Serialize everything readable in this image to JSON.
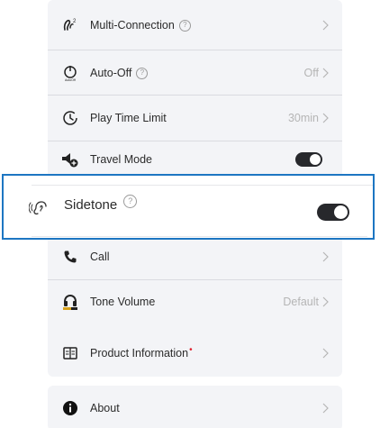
{
  "settings": {
    "multi_connection": {
      "label": "Multi-Connection",
      "icon": "multi-connection-icon"
    },
    "auto_off": {
      "label": "Auto-Off",
      "value": "Off",
      "icon": "auto-off-icon"
    },
    "play_time_limit": {
      "label": "Play Time Limit",
      "value": "30min",
      "icon": "clock-icon"
    },
    "travel_mode": {
      "label": "Travel Mode",
      "icon": "travel-mode-icon",
      "on": true
    },
    "sidetone": {
      "label": "Sidetone",
      "icon": "sidetone-icon",
      "on": true
    },
    "call": {
      "label": "Call",
      "icon": "phone-icon"
    },
    "tone_volume": {
      "label": "Tone Volume",
      "value": "Default",
      "icon": "tone-volume-icon"
    }
  },
  "product_information": {
    "label": "Product Information",
    "badge": "•"
  },
  "about": {
    "label": "About"
  },
  "help_glyph": "?",
  "colors": {
    "card_bg": "#f3f4f7",
    "toggle_on": "#27282c",
    "highlight_border": "#1d76c2",
    "badge_red": "#e0212e",
    "muted_text": "#b5b5b5"
  }
}
